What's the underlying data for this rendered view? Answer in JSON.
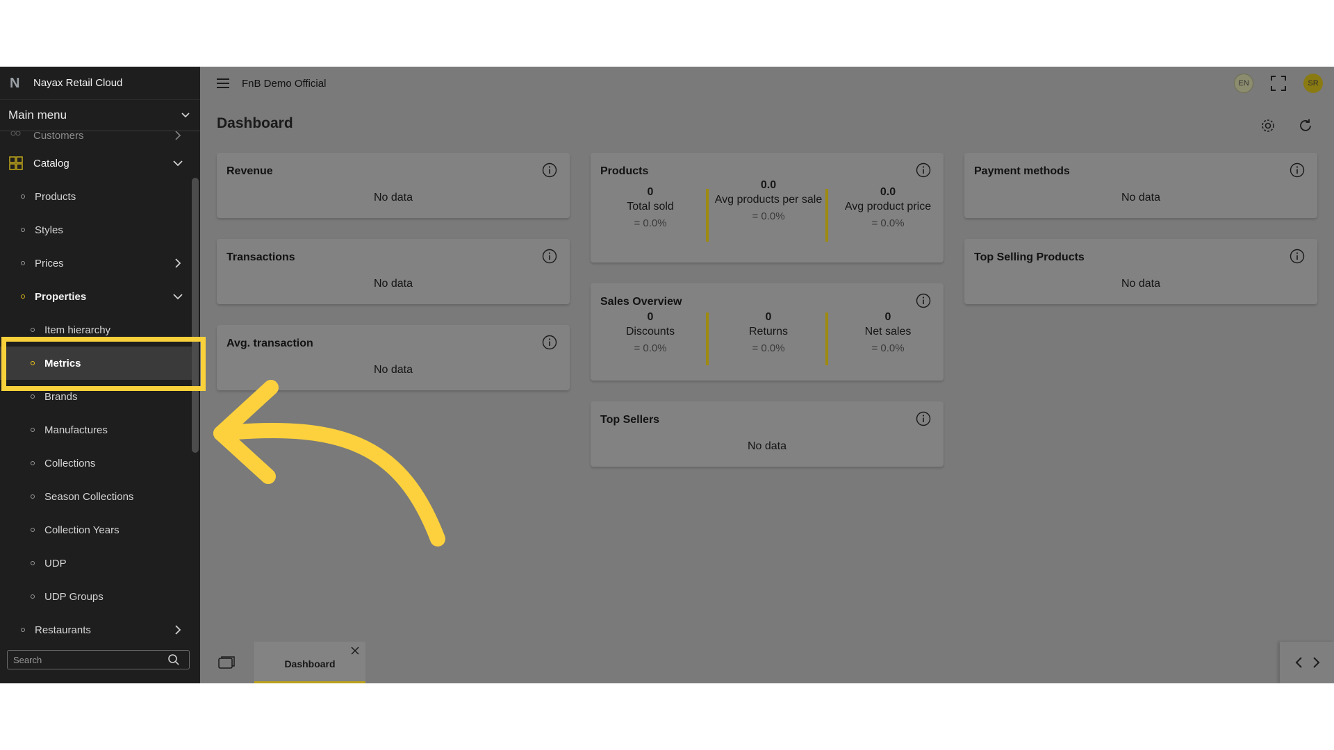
{
  "sidebar": {
    "brand": "Nayax Retail Cloud",
    "main_menu": "Main menu",
    "items": [
      {
        "label": "Customers"
      },
      {
        "label": "Catalog"
      },
      {
        "label": "Products"
      },
      {
        "label": "Styles"
      },
      {
        "label": "Prices"
      },
      {
        "label": "Properties"
      },
      {
        "label": "Item hierarchy"
      },
      {
        "label": "Metrics"
      },
      {
        "label": "Brands"
      },
      {
        "label": "Manufactures"
      },
      {
        "label": "Collections"
      },
      {
        "label": "Season Collections"
      },
      {
        "label": "Collection Years"
      },
      {
        "label": "UDP"
      },
      {
        "label": "UDP Groups"
      },
      {
        "label": "Restaurants"
      }
    ],
    "search_placeholder": "Search"
  },
  "header": {
    "company": "FnB Demo Official",
    "lang": "EN",
    "avatar": "SR"
  },
  "page": {
    "title": "Dashboard"
  },
  "cards": {
    "revenue": {
      "title": "Revenue",
      "nodata": "No data"
    },
    "transactions": {
      "title": "Transactions",
      "nodata": "No data"
    },
    "avg_transaction": {
      "title": "Avg. transaction",
      "nodata": "No data"
    },
    "products": {
      "title": "Products",
      "stats": [
        {
          "value": "0",
          "label": "Total sold",
          "pct": "= 0.0%"
        },
        {
          "value": "0.0",
          "label": "Avg products per sale",
          "pct": "= 0.0%"
        },
        {
          "value": "0.0",
          "label": "Avg product price",
          "pct": "= 0.0%"
        }
      ]
    },
    "sales_overview": {
      "title": "Sales Overview",
      "stats": [
        {
          "value": "0",
          "label": "Discounts",
          "pct": "= 0.0%"
        },
        {
          "value": "0",
          "label": "Returns",
          "pct": "= 0.0%"
        },
        {
          "value": "0",
          "label": "Net sales",
          "pct": "= 0.0%"
        }
      ]
    },
    "top_sellers": {
      "title": "Top Sellers",
      "nodata": "No data"
    },
    "payment_methods": {
      "title": "Payment methods",
      "nodata": "No data"
    },
    "top_selling_products": {
      "title": "Top Selling Products",
      "nodata": "No data"
    }
  },
  "tabbar": {
    "tabs": [
      {
        "label": "Dashboard"
      }
    ]
  },
  "colors": {
    "accent": "#f9d13a",
    "divider": "#9e8a10"
  }
}
